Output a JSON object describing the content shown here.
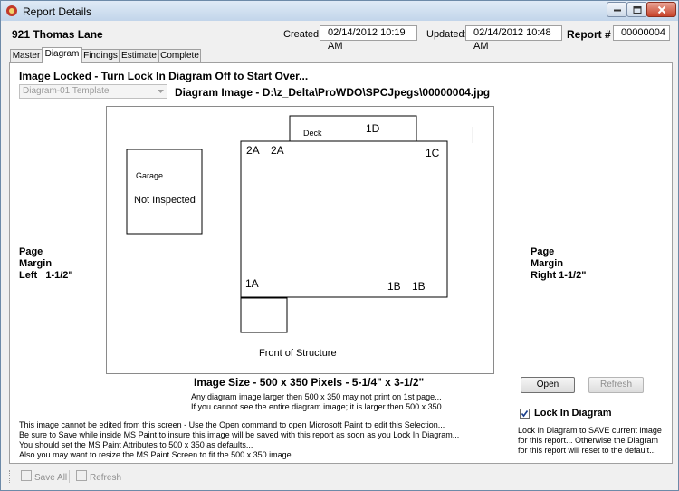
{
  "window": {
    "title": "Report Details"
  },
  "header": {
    "address": "921 Thomas Lane",
    "created_label": "Created:",
    "created_value": "02/14/2012 10:19 AM",
    "updated_label": "Updated:",
    "updated_value": "02/14/2012 10:48 AM",
    "report_label": "Report #",
    "report_value": "00000004"
  },
  "tabs": [
    {
      "label": "Master",
      "active": false
    },
    {
      "label": "Diagram",
      "active": true
    },
    {
      "label": "Findings",
      "active": false
    },
    {
      "label": "Estimate",
      "active": false
    },
    {
      "label": "Complete",
      "active": false
    }
  ],
  "diagram": {
    "locked_message": "Image Locked - Turn Lock In Diagram Off to Start Over...",
    "template_select": "Diagram-01 Template",
    "image_path": "Diagram Image - D:\\z_Delta\\ProWDO\\SPCJpegs\\00000004.jpg",
    "labels": {
      "deck": "Deck",
      "d1": "1D",
      "a2_first": "2A",
      "a2_second": "2A",
      "c1": "1C",
      "garage": "Garage",
      "not_inspected": "Not Inspected",
      "a1": "1A",
      "b1_first": "1B",
      "b1_second": "1B",
      "front": "Front of Structure"
    }
  },
  "margins": {
    "left": [
      "Page",
      "Margin",
      "Left   1-1/2\""
    ],
    "right": [
      "Page",
      "Margin",
      "Right 1-1/2\""
    ]
  },
  "image_size": {
    "title": "Image Size - 500 x 350 Pixels - 5-1/4\" x 3-1/2\"",
    "note1": "Any diagram image larger then 500 x 350 may not print on 1st page...",
    "note2": "If you cannot see the entire diagram image; it is larger then 500 x 350..."
  },
  "buttons": {
    "open": "Open",
    "refresh": "Refresh"
  },
  "lock": {
    "label": "Lock In Diagram",
    "checked": true,
    "note": [
      "Lock In Diagram to SAVE current image",
      "for this report... Otherwise the Diagram",
      "for this report will reset to the default..."
    ]
  },
  "instructions": [
    "This image cannot be edited from this screen - Use the Open command to open Microsoft Paint to edit this Selection...",
    "Be sure to Save while inside MS Paint to insure this image will be saved with this report as soon as you Lock In Diagram...",
    "You should set the MS Paint Attributes to 500 x 350 as defaults...",
    "Also you may want to resize the MS Paint Screen to fit the 500 x 350 image..."
  ],
  "toolbar": {
    "save_all": "Save All",
    "refresh": "Refresh"
  }
}
